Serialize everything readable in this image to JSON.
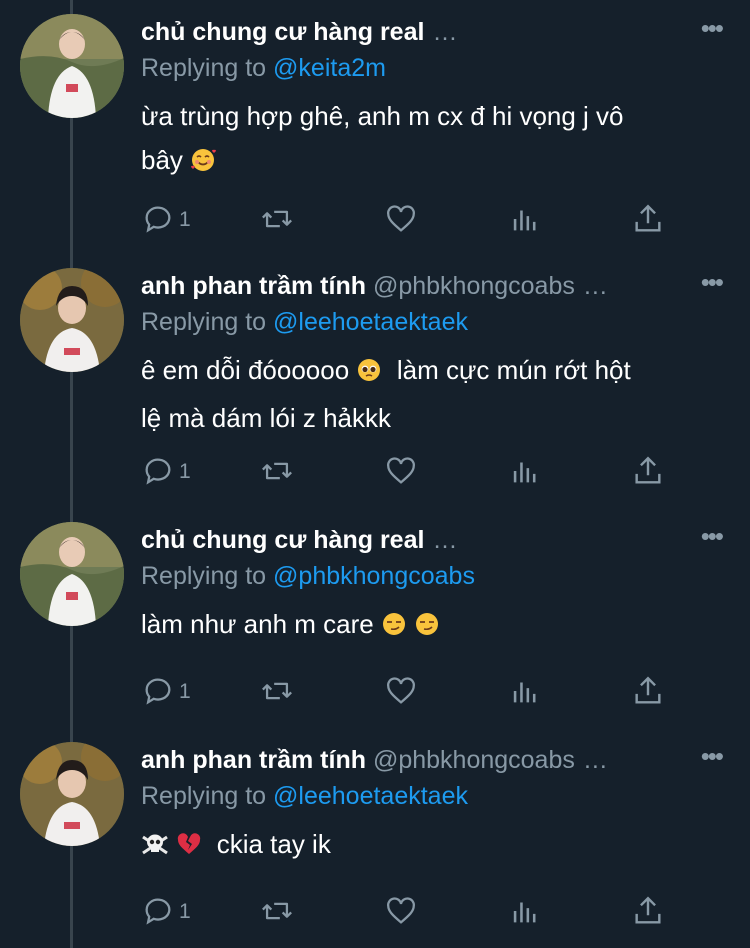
{
  "tweets": [
    {
      "name": "chủ chung cư hàng real",
      "handle": "",
      "replying_label": "Replying to",
      "mention": "@keita2m",
      "text_line1": "ừa trùng hợp ghê, anh m cx đ hi vọng j vô",
      "text_line2": "bây",
      "emoji": [
        "smiling-face-with-hearts"
      ],
      "reply_count": "1"
    },
    {
      "name": "anh phan trầm tính",
      "handle": "@phbkhongcoabs",
      "replying_label": "Replying to",
      "mention": "@leehoetaektaek",
      "text_line1": "ê em dỗi đóooooo",
      "text_line1b": "làm cực mún rớt hột",
      "text_line2": "lệ mà dám lói z hảkkk",
      "emoji": [
        "pleading-face"
      ],
      "reply_count": "1"
    },
    {
      "name": "chủ chung cư hàng real",
      "handle": "",
      "replying_label": "Replying to",
      "mention": "@phbkhongcoabs",
      "text_line1": "làm như anh m care",
      "emoji": [
        "smirking-face",
        "smirking-face"
      ],
      "reply_count": "1"
    },
    {
      "name": "anh phan trầm tính",
      "handle": "@phbkhongcoabs",
      "replying_label": "Replying to",
      "mention": "@leehoetaektaek",
      "text_line1": "ckia tay ik",
      "emoji": [
        "skull-and-crossbones",
        "broken-heart"
      ],
      "reply_count": "1"
    }
  ],
  "ui": {
    "ellipsis": "…",
    "more": "•••"
  },
  "colors": {
    "background": "#15202b",
    "text": "#ffffff",
    "secondary": "#8899a6",
    "mention": "#1d9bf0",
    "thread_line": "#38444d"
  }
}
